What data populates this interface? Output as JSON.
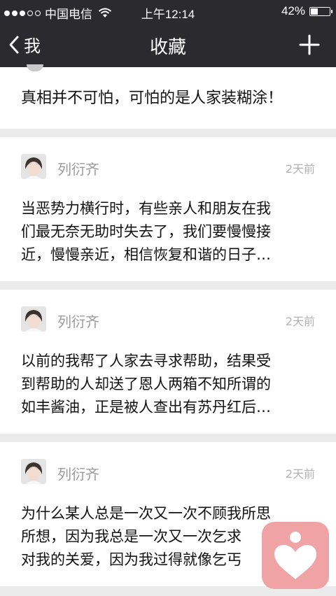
{
  "status_bar": {
    "carrier": "中国电信",
    "time": "上午12:14",
    "battery": "42%",
    "battery_level": 0.42
  },
  "nav": {
    "back_label": "我",
    "title": "收藏"
  },
  "first_item": {
    "text": "真相并不可怕，可怕的是人家装糊涂！"
  },
  "items": [
    {
      "author": "列衍齐",
      "date": "2天前",
      "lines": [
        "当恶势力横行时，有些亲人和朋友在我",
        "们最无奈无助时失去了，我们要慢慢接",
        "近，慢慢亲近，相信恢复和谐的日子…"
      ]
    },
    {
      "author": "列衍齐",
      "date": "2天前",
      "lines": [
        "以前的我帮了人家去寻求帮助，结果受",
        "到帮助的人却送了恩人两箱不知所谓的",
        "如丰酱油，正是被人查出有苏丹红后…"
      ]
    },
    {
      "author": "列衍齐",
      "date": "2天前",
      "lines": [
        "为什么某人总是一次又一次不顾我所思",
        "所想，因为我总是一次又一次乞求",
        "对我的关爱，因为我过得就像乞丐"
      ]
    }
  ],
  "colors": {
    "bar": "#2b2a2f",
    "background": "#ebebeb",
    "badge": "#f0a3a4"
  }
}
